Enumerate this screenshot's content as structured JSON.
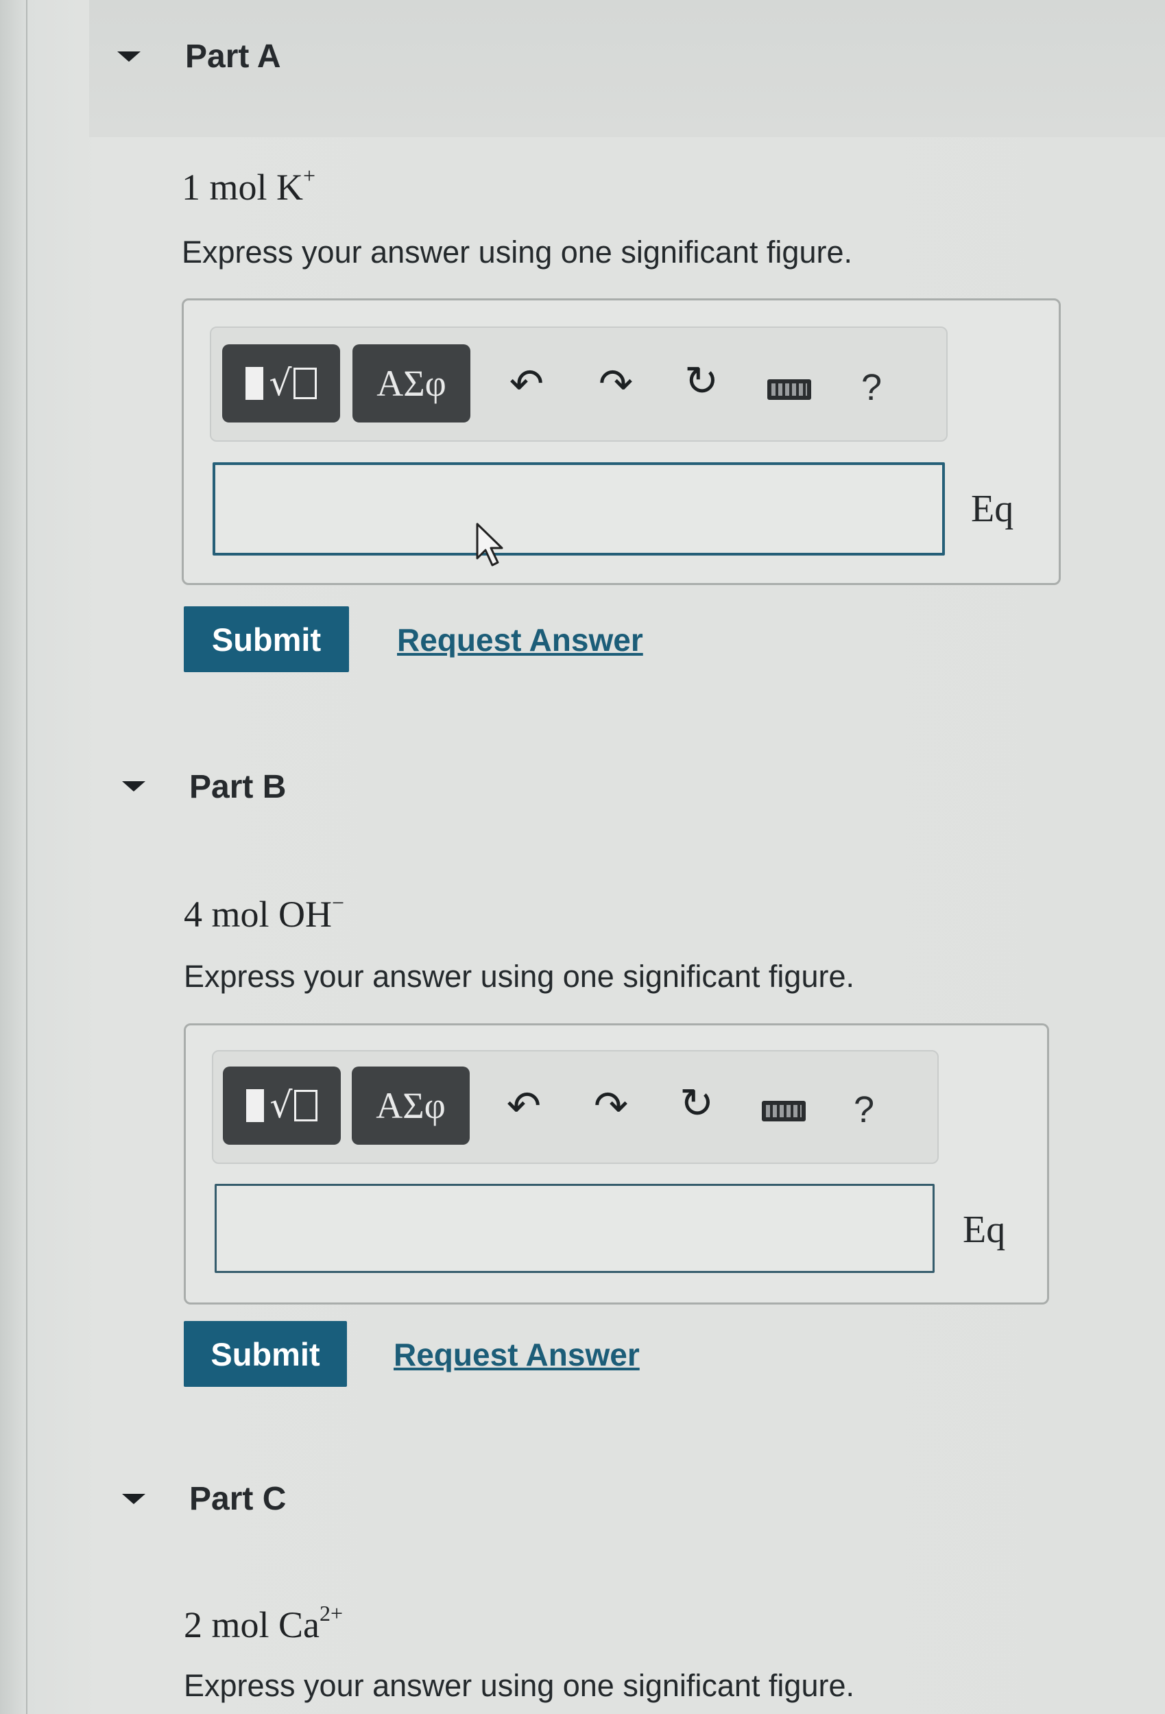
{
  "parts": [
    {
      "title": "Part A",
      "expression_base": "1 mol K",
      "expression_charge": "+",
      "instruction": "Express your answer using one significant figure.",
      "answer_value": "",
      "eq_label": "Eq",
      "submit_label": "Submit",
      "request_label": "Request Answer"
    },
    {
      "title": "Part B",
      "expression_base": "4 mol OH",
      "expression_charge": "−",
      "instruction": "Express your answer using one significant figure.",
      "answer_value": "",
      "eq_label": "Eq",
      "submit_label": "Submit",
      "request_label": "Request Answer"
    },
    {
      "title": "Part C",
      "expression_base": "2 mol Ca",
      "expression_charge": "2+",
      "instruction": "Express your answer using one significant figure."
    }
  ],
  "toolbar": {
    "symbols_label": "ΑΣφ",
    "help_label": "?",
    "icons": [
      "templates-icon",
      "greek-symbols-icon",
      "undo-icon",
      "redo-icon",
      "reset-icon",
      "keyboard-icon",
      "help-icon"
    ]
  },
  "colors": {
    "submit_bg": "#195e7c",
    "link": "#1c5d78",
    "toolbar_button": "#3f4244",
    "input_border": "#255f78"
  }
}
